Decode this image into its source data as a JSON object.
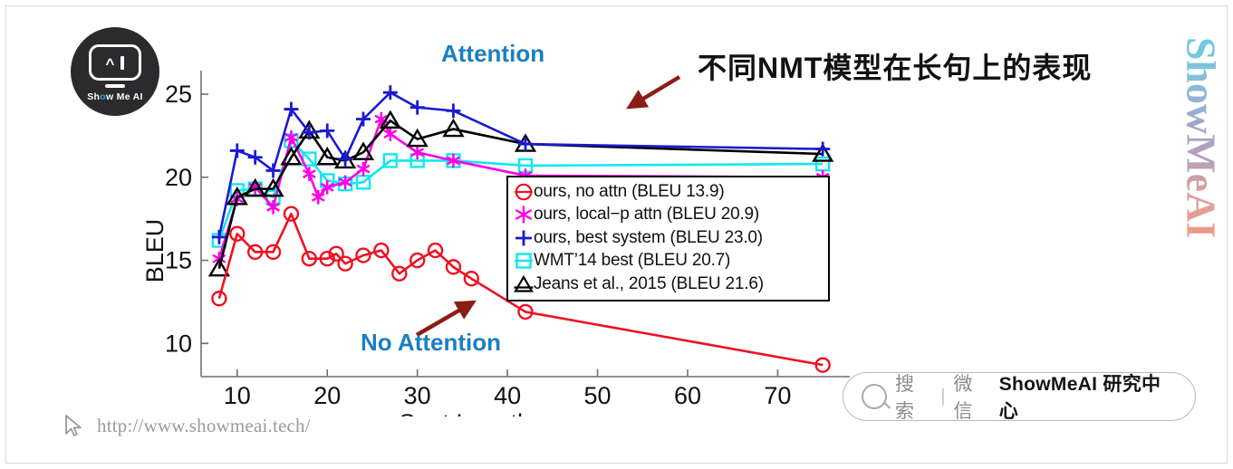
{
  "slide": {
    "title": "不同NMT模型在长句上的表现",
    "vertical_watermark": "ShowMeAI",
    "url": "http://www.showmeai.tech/",
    "cursor_icon": "cursor-arrow-icon"
  },
  "logo": {
    "name": "show-me-ai-logo",
    "text_before": "Sh",
    "text_o": "o",
    "text_after": "w Me AI",
    "robot_icon": "robot-face-icon"
  },
  "search_pill": {
    "search_icon": "magnifier-icon",
    "search_label": "搜索",
    "divider": "|",
    "channel_label": "微信",
    "brand": "ShowMeAI 研究中心"
  },
  "annotations": [
    {
      "text": "Attention",
      "color": "#1a7fc1",
      "arrow": "arrow-down-left-icon"
    },
    {
      "text": "No Attention",
      "color": "#1a7fc1",
      "arrow": "arrow-up-right-icon"
    }
  ],
  "chart_data": {
    "type": "line",
    "title": "",
    "xlabel": "Sent Lengths",
    "ylabel": "BLEU",
    "xlim": [
      6,
      78
    ],
    "ylim": [
      8,
      26.2
    ],
    "xticks": [
      10,
      20,
      30,
      40,
      50,
      60,
      70
    ],
    "yticks": [
      10,
      15,
      20,
      25
    ],
    "grid": false,
    "legend_position": "inside-lower-right",
    "legend_box": true,
    "colors": {
      "no_attn": "#ee1122",
      "local_p": "#ff00e6",
      "best_system": "#1a1ad0",
      "wmt14": "#10e8f0",
      "jeans": "#000000",
      "annotation": "#1a7fc1",
      "arrow": "#8c1c16"
    },
    "markers": {
      "no_attn": "circle",
      "local_p": "asterisk",
      "best_system": "plus",
      "wmt14": "square",
      "jeans": "triangle"
    },
    "series": [
      {
        "name": "ours, no attn (BLEU 13.9)",
        "legend_label": "ours, no attn (BLEU 13.9)",
        "color": "#ee1122",
        "marker": "circle",
        "x": [
          8,
          10,
          12,
          14,
          16,
          18,
          20,
          21,
          22,
          24,
          26,
          28,
          30,
          32,
          34,
          36,
          42,
          75
        ],
        "y": [
          12.7,
          16.6,
          15.5,
          15.5,
          17.8,
          15.1,
          15.1,
          15.4,
          14.8,
          15.3,
          15.6,
          14.2,
          15.0,
          15.6,
          14.6,
          13.9,
          11.9,
          8.7
        ]
      },
      {
        "name": "ours, local-p attn (BLEU 20.9)",
        "legend_label": "ours, local−p attn (BLEU 20.9)",
        "color": "#ff00e6",
        "marker": "asterisk",
        "x": [
          8,
          10,
          12,
          14,
          16,
          18,
          19,
          20,
          22,
          24,
          26,
          27,
          30,
          34,
          42,
          75
        ],
        "y": [
          15.1,
          18.7,
          19.4,
          18.2,
          22.4,
          20.2,
          18.8,
          19.4,
          19.7,
          20.5,
          23.5,
          22.6,
          21.5,
          21.0,
          20.1,
          20.0
        ]
      },
      {
        "name": "ours, best system (BLEU 23.0)",
        "legend_label": "ours, best system (BLEU 23.0)",
        "color": "#1a1ad0",
        "marker": "plus",
        "x": [
          8,
          10,
          12,
          14,
          16,
          18,
          20,
          22,
          24,
          27,
          30,
          34,
          42,
          75
        ],
        "y": [
          16.4,
          21.6,
          21.2,
          20.4,
          24.1,
          22.7,
          22.8,
          21.1,
          23.5,
          25.1,
          24.2,
          24.0,
          22.0,
          21.7
        ]
      },
      {
        "name": "WMT'14 best (BLEU 20.7)",
        "legend_label": "WMT’14 best (BLEU 20.7)",
        "color": "#10e8f0",
        "marker": "square",
        "x": [
          8,
          10,
          12,
          14,
          16,
          18,
          20,
          22,
          24,
          27,
          30,
          34,
          42,
          75
        ],
        "y": [
          16.2,
          19.2,
          19.3,
          18.8,
          22.2,
          21.1,
          19.8,
          19.6,
          19.7,
          21.0,
          21.0,
          21.0,
          20.7,
          20.8
        ]
      },
      {
        "name": "Jeans et al., 2015 (BLEU 21.6)",
        "legend_label": "Jeans et al., 2015 (BLEU 21.6)",
        "color": "#000000",
        "marker": "triangle",
        "x": [
          8,
          10,
          12,
          14,
          16,
          18,
          20,
          22,
          24,
          27,
          30,
          34,
          42,
          75
        ],
        "y": [
          14.5,
          18.8,
          19.3,
          19.3,
          21.2,
          22.8,
          21.2,
          21.0,
          21.5,
          23.4,
          22.3,
          22.9,
          22.0,
          21.4
        ]
      }
    ]
  }
}
